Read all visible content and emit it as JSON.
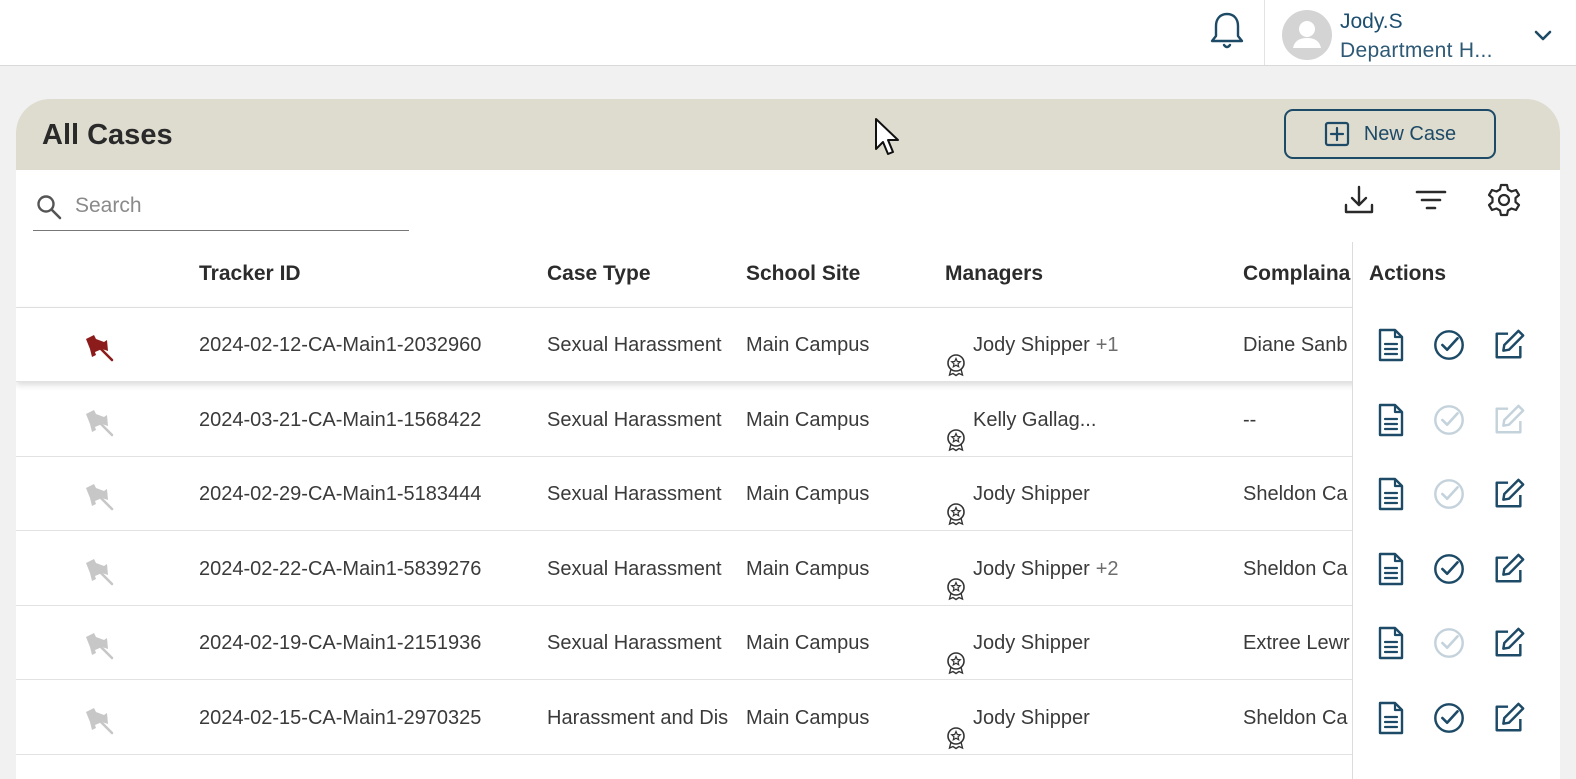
{
  "header": {
    "user_name": "Jody.S",
    "user_role": "Department H..."
  },
  "panel": {
    "title": "All Cases",
    "new_case_label": "New Case"
  },
  "search": {
    "placeholder": "Search",
    "value": ""
  },
  "table": {
    "columns": [
      "Tracker ID",
      "Case Type",
      "School Site",
      "Managers",
      "Complaina",
      "Actions"
    ],
    "rows": [
      {
        "pinned": true,
        "tracker_id": "2024-02-12-CA-Main1-2032960",
        "case_type": "Sexual Harassment",
        "school_site": "Main Campus",
        "manager": "Jody Shipper",
        "manager_extra": "+1",
        "complainant": "Diane Sanb",
        "review_enabled": true,
        "edit_enabled": true
      },
      {
        "pinned": false,
        "tracker_id": "2024-03-21-CA-Main1-1568422",
        "case_type": "Sexual Harassment",
        "school_site": "Main Campus",
        "manager": "Kelly Gallag...",
        "manager_extra": "",
        "complainant": "--",
        "review_enabled": false,
        "edit_enabled": false
      },
      {
        "pinned": false,
        "tracker_id": "2024-02-29-CA-Main1-5183444",
        "case_type": "Sexual Harassment",
        "school_site": "Main Campus",
        "manager": "Jody Shipper",
        "manager_extra": "",
        "complainant": "Sheldon Ca",
        "review_enabled": false,
        "edit_enabled": true
      },
      {
        "pinned": false,
        "tracker_id": "2024-02-22-CA-Main1-5839276",
        "case_type": "Sexual Harassment",
        "school_site": "Main Campus",
        "manager": "Jody Shipper",
        "manager_extra": "+2",
        "complainant": "Sheldon Ca",
        "review_enabled": true,
        "edit_enabled": true
      },
      {
        "pinned": false,
        "tracker_id": "2024-02-19-CA-Main1-2151936",
        "case_type": "Sexual Harassment",
        "school_site": "Main Campus",
        "manager": "Jody Shipper",
        "manager_extra": "",
        "complainant": "Extree Lewr",
        "review_enabled": false,
        "edit_enabled": true
      },
      {
        "pinned": false,
        "tracker_id": "2024-02-15-CA-Main1-2970325",
        "case_type": "Harassment and Dis",
        "school_site": "Main Campus",
        "manager": "Jody Shipper",
        "manager_extra": "",
        "complainant": "Sheldon Ca",
        "review_enabled": true,
        "edit_enabled": true
      }
    ]
  },
  "icons": {
    "notification": "bell-icon",
    "user": "avatar-icon",
    "dropdown": "chevron-down-icon",
    "add": "plus-square-icon",
    "search": "search-icon",
    "download": "download-icon",
    "filter": "filter-icon",
    "settings": "gear-icon",
    "pin": "pushpin-icon",
    "manager": "award-badge-icon",
    "document": "document-icon",
    "review": "check-circle-icon",
    "edit": "edit-icon"
  },
  "colors": {
    "accent": "#1d4a66",
    "header_band": "#dedbcf",
    "pin_active": "#8c1c1c",
    "pin_inactive": "#c7c7c7",
    "action_disabled": "#c4d3db"
  }
}
